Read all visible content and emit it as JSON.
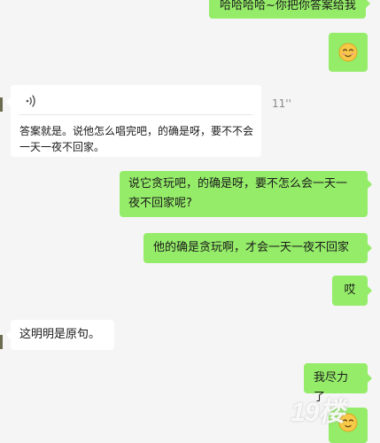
{
  "messages": {
    "m1": "哈哈哈哈~你把你答案给我",
    "voice_duration": "11''",
    "voice_transcript_line1": "答案就是。说他怎么唱完吧，的确是呀，要不不会",
    "voice_transcript_line2": "一天一夜不回家。",
    "m3_line1": "说它贪玩吧，的确是呀，要不怎么会一天一",
    "m3_line2": "夜不回家呢?",
    "m4": "他的确是贪玩啊，才会一天一夜不回家",
    "m5": "哎",
    "m6": "这明明是原句。",
    "m7": "我尽力了"
  },
  "watermark": {
    "text": "19楼"
  },
  "colors": {
    "sent": "#95ec69",
    "received": "#ffffff",
    "background": "#f5f5f5"
  },
  "icons": {
    "emoji": "smiling-face-emoji",
    "voice": "voice-wave-icon"
  }
}
